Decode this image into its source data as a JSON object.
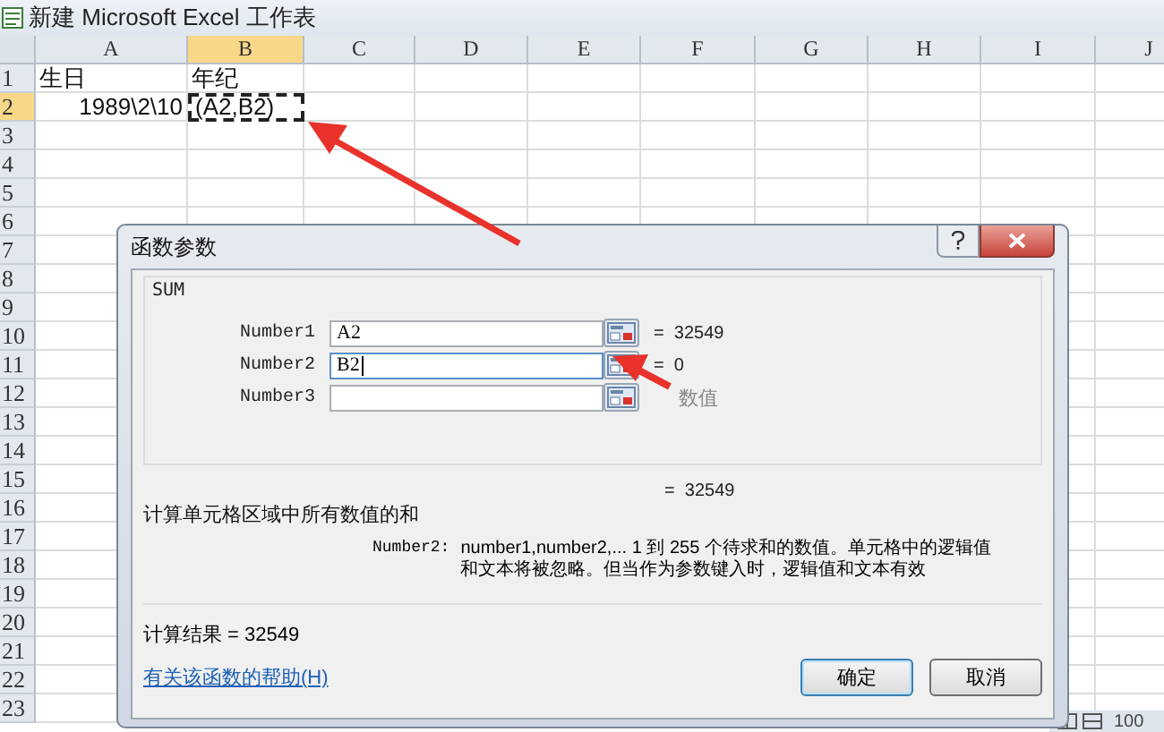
{
  "window": {
    "title": "新建 Microsoft Excel 工作表"
  },
  "columns": [
    {
      "label": "A",
      "selected": false
    },
    {
      "label": "B",
      "selected": true
    },
    {
      "label": "C",
      "selected": false
    },
    {
      "label": "D",
      "selected": false
    },
    {
      "label": "E",
      "selected": false
    },
    {
      "label": "F",
      "selected": false
    },
    {
      "label": "G",
      "selected": false
    },
    {
      "label": "H",
      "selected": false
    },
    {
      "label": "I",
      "selected": false
    },
    {
      "label": "J",
      "selected": false
    }
  ],
  "rows": [
    {
      "label": "1",
      "selected": false,
      "cells": [
        {
          "text": "生日",
          "kind": "text",
          "selected": false
        },
        {
          "text": "年纪",
          "kind": "text",
          "selected": false
        }
      ]
    },
    {
      "label": "2",
      "selected": true,
      "cells": [
        {
          "text": "1989\\2\\10",
          "kind": "number",
          "selected": false
        },
        {
          "text": "(A2,B2)",
          "kind": "text",
          "selected": true
        }
      ]
    },
    {
      "label": "3",
      "selected": false
    },
    {
      "label": "4",
      "selected": false
    },
    {
      "label": "5",
      "selected": false
    },
    {
      "label": "6",
      "selected": false
    },
    {
      "label": "7",
      "selected": false
    },
    {
      "label": "8",
      "selected": false
    },
    {
      "label": "9",
      "selected": false
    },
    {
      "label": "10",
      "selected": false
    },
    {
      "label": "11",
      "selected": false
    },
    {
      "label": "12",
      "selected": false
    },
    {
      "label": "13",
      "selected": false
    },
    {
      "label": "14",
      "selected": false
    },
    {
      "label": "15",
      "selected": false
    },
    {
      "label": "16",
      "selected": false
    },
    {
      "label": "17",
      "selected": false
    },
    {
      "label": "18",
      "selected": false
    },
    {
      "label": "19",
      "selected": false
    },
    {
      "label": "20",
      "selected": false
    },
    {
      "label": "21",
      "selected": false
    },
    {
      "label": "22",
      "selected": false
    },
    {
      "label": "23",
      "selected": false
    }
  ],
  "dialog": {
    "title": "函数参数",
    "function_name": "SUM",
    "arguments": [
      {
        "label": "Number1",
        "value": "A2",
        "focused": false,
        "result": "=  32549",
        "kind": "value"
      },
      {
        "label": "Number2",
        "value": "B2",
        "focused": true,
        "result": "=  0",
        "kind": "value"
      },
      {
        "label": "Number3",
        "focused": false,
        "result": "数值",
        "kind": "hint"
      }
    ],
    "total": "=  32549",
    "description": "计算单元格区域中所有数值的和",
    "argument_help": {
      "name": "Number2:",
      "lines": [
        "number1,number2,...   1 到 255 个待求和的数值。单元格中的逻辑值",
        "和文本将被忽略。但当作为参数键入时，逻辑值和文本有效"
      ]
    },
    "result_line": "计算结果 =  32549",
    "help_link": "有关该函数的帮助(H)",
    "buttons": [
      "确定",
      "取消"
    ]
  },
  "status_bar": {
    "zoom": "100"
  }
}
